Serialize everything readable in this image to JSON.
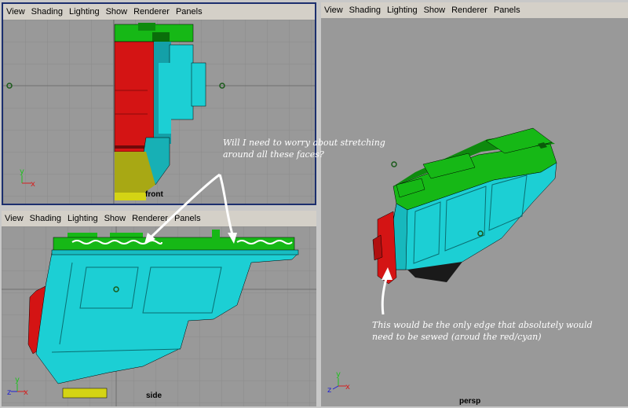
{
  "menu": [
    "View",
    "Shading",
    "Lighting",
    "Show",
    "Renderer",
    "Panels"
  ],
  "panels": {
    "front": {
      "label": "front"
    },
    "side": {
      "label": "side"
    },
    "persp": {
      "label": "persp"
    }
  },
  "axes": {
    "x": "x",
    "y": "y",
    "z": "z"
  },
  "annotations": {
    "stretch_line1": "Will I need to worry about stretching",
    "stretch_line2": "around all these faces?",
    "sew_line1": "This would be the only edge that absolutely would",
    "sew_line2": "need to be sewed (aroud the red/cyan)"
  },
  "colors": {
    "viewport_bg": "#999999",
    "active_border": "#1c2f6e",
    "menubar_bg": "#d4d0c8",
    "mesh_red": "#d41414",
    "mesh_cyan": "#1ccfd4",
    "mesh_green": "#16b816",
    "mesh_yellow": "#d4d414",
    "axis_x": "#d42020",
    "axis_y": "#20c020",
    "axis_z": "#2020d4"
  }
}
